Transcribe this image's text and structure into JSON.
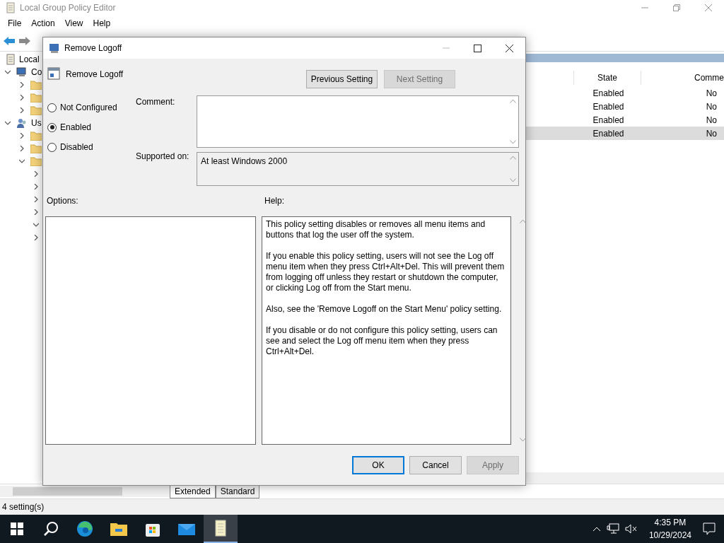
{
  "window": {
    "title": "Local Group Policy Editor"
  },
  "menu": [
    "File",
    "Action",
    "View",
    "Help"
  ],
  "tree": [
    {
      "kind": "root",
      "label": "Local",
      "children": [
        {
          "kind": "computer",
          "label": "Co",
          "expanded": true,
          "children": [
            {
              "kind": "folder",
              "expanded": false
            },
            {
              "kind": "folder",
              "expanded": false
            },
            {
              "kind": "folder",
              "expanded": false
            }
          ]
        },
        {
          "kind": "user",
          "label": "Us",
          "expanded": true,
          "children": [
            {
              "kind": "folder",
              "expanded": false
            },
            {
              "kind": "folder",
              "expanded": false
            },
            {
              "kind": "folder",
              "expanded": true,
              "children": [
                {
                  "expanded": false
                },
                {
                  "expanded": false
                },
                {
                  "expanded": false
                },
                {
                  "expanded": false
                },
                {
                  "expanded": true
                },
                {
                  "expanded": false
                }
              ]
            }
          ]
        }
      ]
    }
  ],
  "table": {
    "columns": [
      "State",
      "Comme"
    ],
    "rows": [
      {
        "state": "Enabled",
        "comment": "No",
        "selected": false
      },
      {
        "state": "Enabled",
        "comment": "No",
        "selected": false
      },
      {
        "state": "Enabled",
        "comment": "No",
        "selected": false
      },
      {
        "state": "Enabled",
        "comment": "No",
        "selected": true
      }
    ]
  },
  "view_tabs": [
    {
      "label": "Extended",
      "selected": true
    },
    {
      "label": "Standard",
      "selected": false
    }
  ],
  "status_bar": "4 setting(s)",
  "dialog": {
    "title": "Remove Logoff",
    "setting": "Remove Logoff",
    "nav_buttons": [
      {
        "label": "Previous Setting",
        "disabled": false
      },
      {
        "label": "Next Setting",
        "disabled": true
      }
    ],
    "options": [
      {
        "label": "Not Configured",
        "selected": false
      },
      {
        "label": "Enabled",
        "selected": true
      },
      {
        "label": "Disabled",
        "selected": false
      }
    ],
    "comment_label": "Comment:",
    "supported_label": "Supported on:",
    "supported_value": "At least Windows 2000",
    "options_label": "Options:",
    "help_label": "Help:",
    "help": [
      "This policy setting disables or removes all menu items and buttons that log the user off the system.",
      "If you enable this policy setting, users will not see the Log off menu item when they press Ctrl+Alt+Del. This will prevent them from logging off unless they restart or shutdown the computer, or clicking Log off from the Start menu.",
      "Also, see the 'Remove Logoff on the Start Menu' policy setting.",
      "If you disable or do not configure this policy setting, users can see and select the Log off menu item when they press Ctrl+Alt+Del."
    ],
    "buttons": [
      {
        "label": "OK",
        "disabled": false,
        "default": true
      },
      {
        "label": "Cancel",
        "disabled": false,
        "default": false
      },
      {
        "label": "Apply",
        "disabled": true,
        "default": false
      }
    ]
  },
  "taskbar": {
    "time": "4:35 PM",
    "date": "10/29/2024"
  }
}
